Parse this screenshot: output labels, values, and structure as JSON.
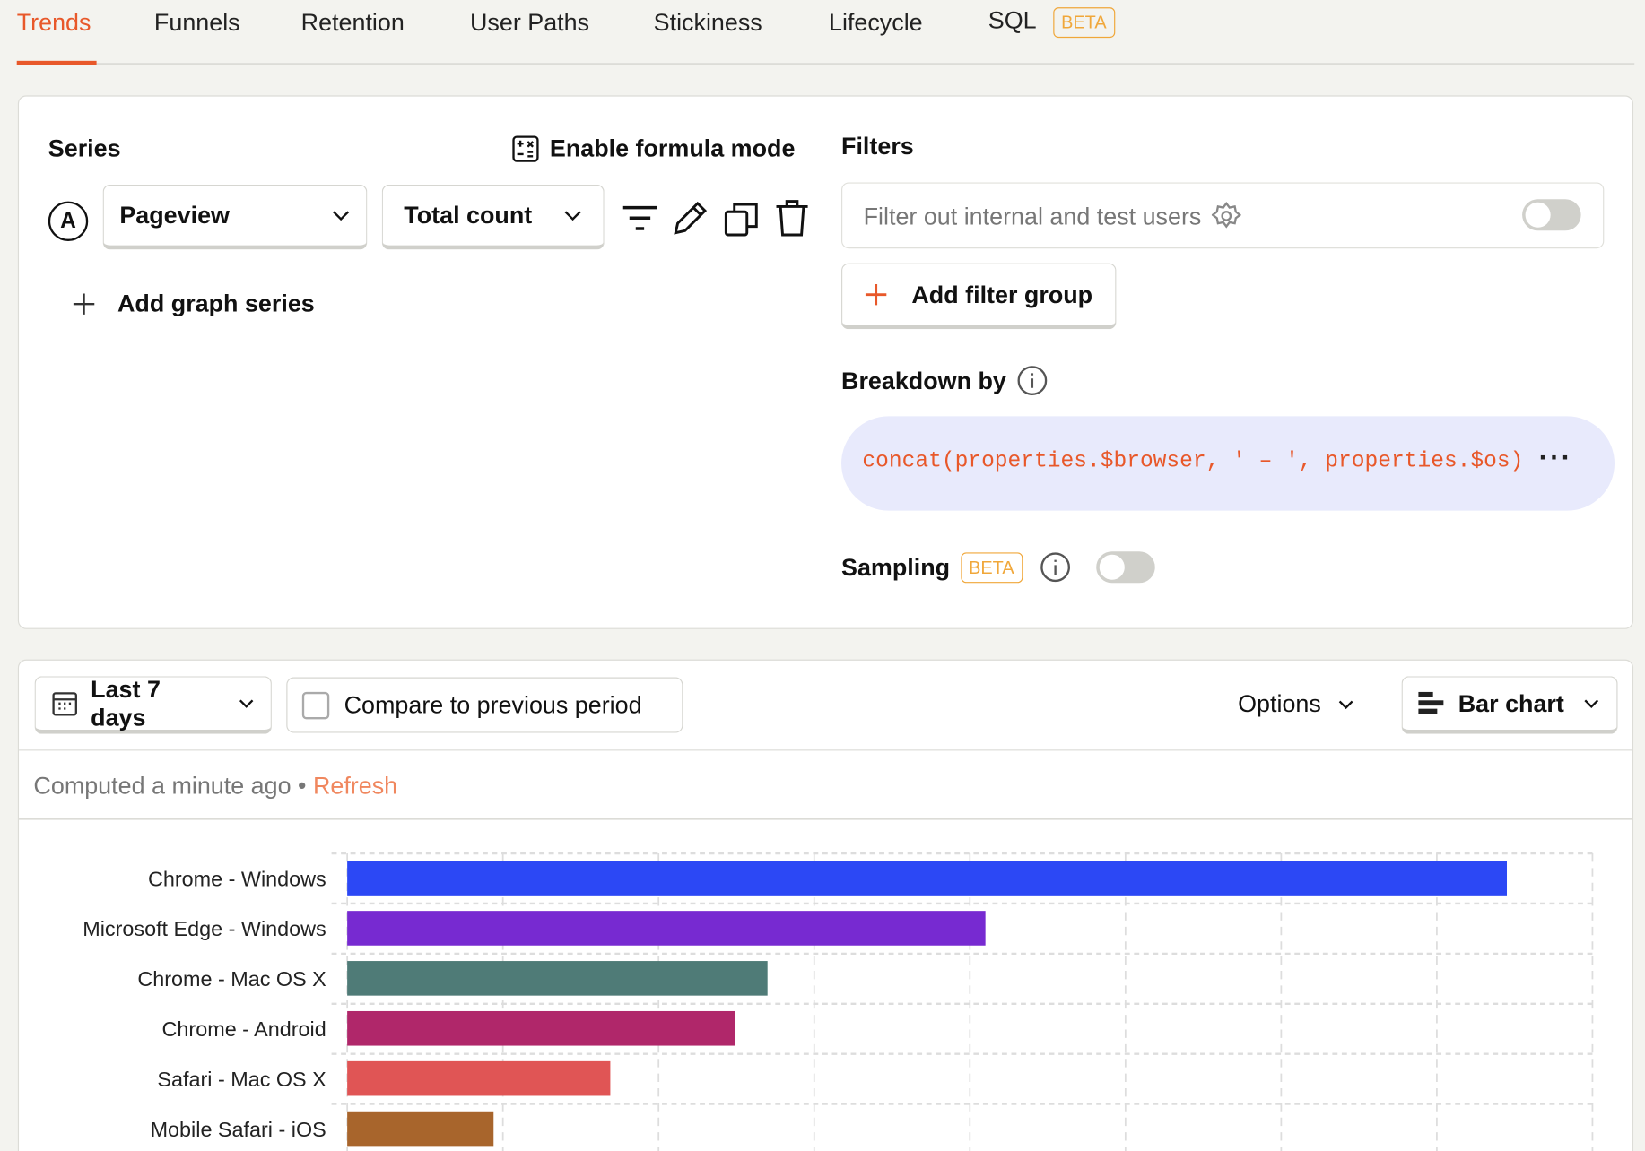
{
  "tabs": [
    {
      "label": "Trends",
      "active": true
    },
    {
      "label": "Funnels"
    },
    {
      "label": "Retention"
    },
    {
      "label": "User Paths"
    },
    {
      "label": "Stickiness"
    },
    {
      "label": "Lifecycle"
    },
    {
      "label": "SQL",
      "badge": "BETA"
    }
  ],
  "series": {
    "title": "Series",
    "formula_label": "Enable formula mode",
    "letter": "A",
    "event": "Pageview",
    "aggregation": "Total count",
    "add_label": "Add graph series"
  },
  "filters": {
    "title": "Filters",
    "internal_label": "Filter out internal and test users",
    "internal_enabled": false,
    "add_group_label": "Add filter group"
  },
  "breakdown": {
    "title": "Breakdown by",
    "expression": "concat(properties.$browser, ' – ', properties.$os)"
  },
  "sampling": {
    "title": "Sampling",
    "badge": "BETA",
    "enabled": false
  },
  "toolbar": {
    "date_range": "Last 7 days",
    "compare_label": "Compare to previous period",
    "compare_checked": false,
    "options_label": "Options",
    "chart_type": "Bar chart"
  },
  "status": {
    "computed": "Computed a minute ago",
    "separator": "•",
    "refresh": "Refresh"
  },
  "colors": {
    "accent": "#e8582a",
    "beta": "#f0a73a",
    "breakdown_bg": "#e8eafc"
  },
  "chart_data": {
    "type": "bar",
    "orientation": "horizontal",
    "grid": true,
    "categories": [
      "Chrome - Windows",
      "Microsoft Edge - Windows",
      "Chrome - Mac OS X",
      "Chrome - Android",
      "Safari - Mac OS X",
      "Mobile Safari - iOS"
    ],
    "values": [
      7.45,
      4.1,
      2.7,
      2.49,
      1.69,
      0.94
    ],
    "colors": [
      "#2c48f5",
      "#772ad1",
      "#4f7b77",
      "#b0276a",
      "#e05555",
      "#a8652c"
    ],
    "xlim": [
      0,
      8
    ]
  }
}
